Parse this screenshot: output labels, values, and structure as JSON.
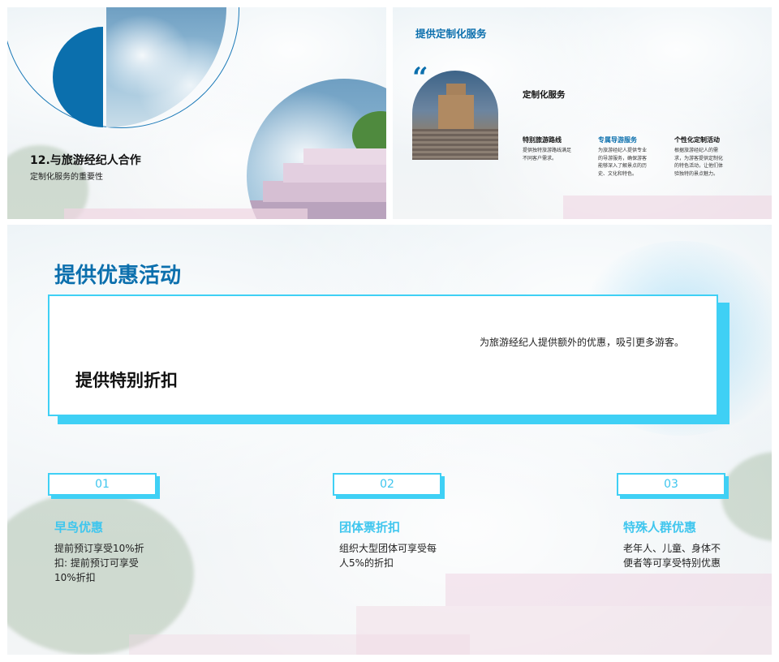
{
  "slide1": {
    "title": "12.与旅游经纪人合作",
    "subtitle": "定制化服务的重要性"
  },
  "slide2": {
    "heading": "提供定制化服务",
    "quote_mark": "“",
    "subheading": "定制化服务",
    "columns": [
      {
        "title": "特别旅游路线",
        "body": "提供独特旅游路线满足不同客户需求。",
        "color": "#111111"
      },
      {
        "title": "专属导游服务",
        "body": "为旅游经纪人提供专业的导游服务，确保游客能够深入了解景点的历史、文化和特色。",
        "color": "#0b6fad"
      },
      {
        "title": "个性化定制活动",
        "body": "根据旅游经纪人的需求，为游客提供定制化的特色活动，让他们体验独特的景点魅力。",
        "color": "#111111"
      }
    ]
  },
  "slide3": {
    "title": "提供优惠活动",
    "card": {
      "description": "为旅游经纪人提供额外的优惠，吸引更多游客。",
      "title": "提供特别折扣"
    },
    "features": [
      {
        "number": "01",
        "title": "早鸟优惠",
        "body": "提前预订享受10%折扣: 提前预订可享受10%折扣"
      },
      {
        "number": "02",
        "title": "团体票折扣",
        "body": "组织大型团体可享受每人5%的折扣"
      },
      {
        "number": "03",
        "title": "特殊人群优惠",
        "body": "老年人、儿童、身体不便者等可享受特别优惠"
      }
    ]
  },
  "colors": {
    "accent_blue": "#0b6fad",
    "accent_cyan": "#3fd0f5"
  }
}
